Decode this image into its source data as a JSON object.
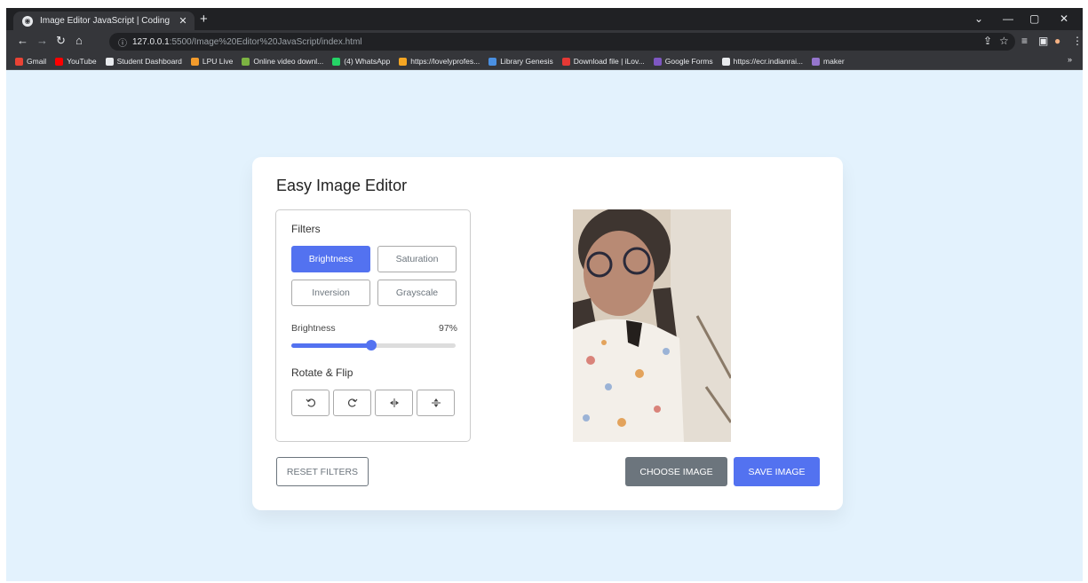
{
  "browser": {
    "tab_title": "Image Editor JavaScript | Coding",
    "url_host": "127.0.0.1",
    "url_rest": ":5500/Image%20Editor%20JavaScript/index.html"
  },
  "bookmarks": [
    {
      "label": "Gmail",
      "color": "#ea4335"
    },
    {
      "label": "YouTube",
      "color": "#ff0000"
    },
    {
      "label": "Student Dashboard",
      "color": "#e8eaed"
    },
    {
      "label": "LPU Live",
      "color": "#f29b2c"
    },
    {
      "label": "Online video downl...",
      "color": "#7cb342"
    },
    {
      "label": "(4) WhatsApp",
      "color": "#25d366"
    },
    {
      "label": "https://lovelyprofes...",
      "color": "#f5a623"
    },
    {
      "label": "Library Genesis",
      "color": "#4a90e2"
    },
    {
      "label": "Download file | iLov...",
      "color": "#e53935"
    },
    {
      "label": "Google Forms",
      "color": "#7e57c2"
    },
    {
      "label": "https://ecr.indianrai...",
      "color": "#e8eaed"
    },
    {
      "label": "maker",
      "color": "#9575cd"
    }
  ],
  "editor": {
    "title": "Easy Image Editor",
    "filters_title": "Filters",
    "filters": [
      {
        "label": "Brightness",
        "active": true
      },
      {
        "label": "Saturation",
        "active": false
      },
      {
        "label": "Inversion",
        "active": false
      },
      {
        "label": "Grayscale",
        "active": false
      }
    ],
    "slider": {
      "name": "Brightness",
      "value_text": "97%",
      "value": 97,
      "max": 200
    },
    "rotate_title": "Rotate & Flip",
    "rotate_buttons": [
      "rotate-left-icon",
      "rotate-right-icon",
      "flip-horizontal-icon",
      "flip-vertical-icon"
    ],
    "reset_label": "RESET FILTERS",
    "choose_label": "CHOOSE IMAGE",
    "save_label": "SAVE IMAGE"
  },
  "colors": {
    "accent": "#5372f0",
    "secondary": "#6c757d",
    "page_bg": "#e3f2fd"
  }
}
